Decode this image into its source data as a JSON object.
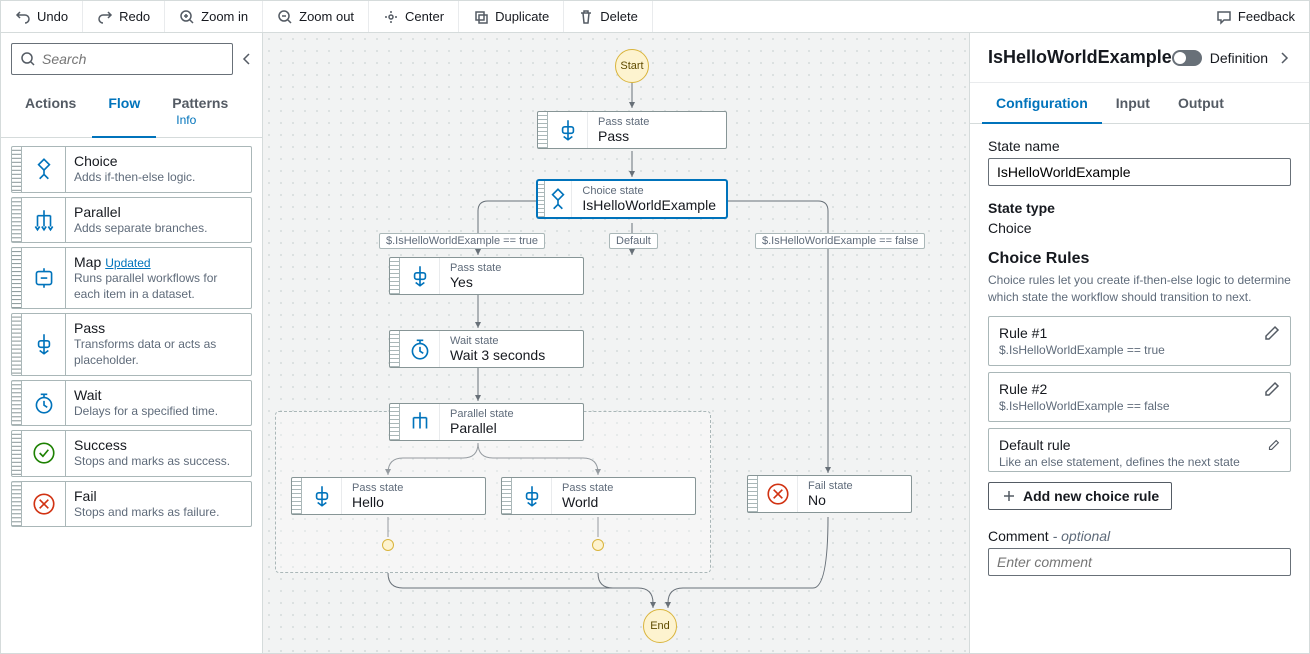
{
  "toolbar": {
    "undo": "Undo",
    "redo": "Redo",
    "zoom_in": "Zoom in",
    "zoom_out": "Zoom out",
    "center": "Center",
    "duplicate": "Duplicate",
    "delete": "Delete",
    "feedback": "Feedback"
  },
  "sidebar": {
    "search_placeholder": "Search",
    "tabs": {
      "actions": "Actions",
      "flow": "Flow",
      "patterns": "Patterns",
      "info": "Info"
    },
    "items": [
      {
        "title": "Choice",
        "desc": "Adds if-then-else logic.",
        "icon": "choice"
      },
      {
        "title": "Parallel",
        "desc": "Adds separate branches.",
        "icon": "parallel"
      },
      {
        "title": "Map",
        "desc": "Runs parallel workflows for each item in a dataset.",
        "icon": "map",
        "badge": "Updated"
      },
      {
        "title": "Pass",
        "desc": "Transforms data or acts as placeholder.",
        "icon": "pass"
      },
      {
        "title": "Wait",
        "desc": "Delays for a specified time.",
        "icon": "wait"
      },
      {
        "title": "Success",
        "desc": "Stops and marks as success.",
        "icon": "success"
      },
      {
        "title": "Fail",
        "desc": "Stops and marks as failure.",
        "icon": "fail"
      }
    ]
  },
  "canvas": {
    "start": "Start",
    "end": "End",
    "labels": {
      "cond_true": "$.IsHelloWorldExample == true",
      "default": "Default",
      "cond_false": "$.IsHelloWorldExample == false"
    },
    "state_type_labels": {
      "pass": "Pass state",
      "choice": "Choice state",
      "wait": "Wait state",
      "parallel": "Parallel state",
      "fail": "Fail state"
    },
    "nodes": {
      "pass": "Pass",
      "choice": "IsHelloWorldExample",
      "yes": "Yes",
      "wait": "Wait 3 seconds",
      "parallel": "Parallel",
      "hello": "Hello",
      "world": "World",
      "no": "No"
    }
  },
  "inspector": {
    "title": "IsHelloWorldExample",
    "definition": "Definition",
    "tabs": {
      "config": "Configuration",
      "input": "Input",
      "output": "Output"
    },
    "state_name_label": "State name",
    "state_name_value": "IsHelloWorldExample",
    "state_type_label": "State type",
    "state_type_value": "Choice",
    "rules_title": "Choice Rules",
    "rules_desc": "Choice rules let you create if-then-else logic to determine which state the workflow should transition to next.",
    "rules": [
      {
        "title": "Rule #1",
        "sub": "$.IsHelloWorldExample == true"
      },
      {
        "title": "Rule #2",
        "sub": "$.IsHelloWorldExample == false"
      }
    ],
    "default_rule": {
      "title": "Default rule",
      "sub": "Like an else statement, defines the next state when no rule is true."
    },
    "add_rule": "Add new choice rule",
    "comment_label": "Comment",
    "comment_opt": "- optional",
    "comment_placeholder": "Enter comment"
  }
}
